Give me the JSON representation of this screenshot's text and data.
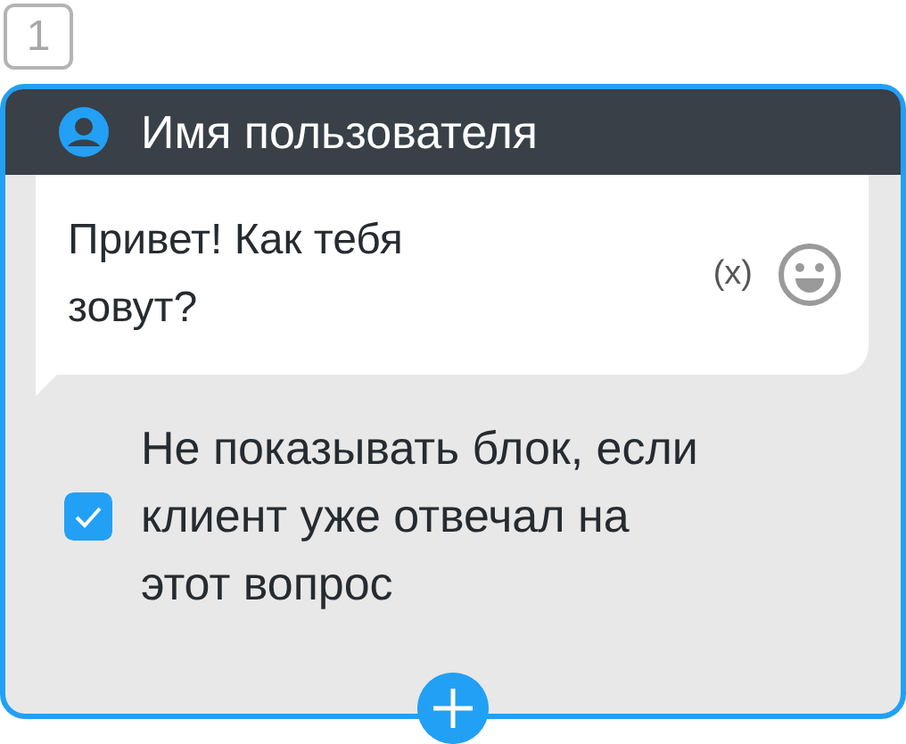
{
  "block_number": "1",
  "header": {
    "title": "Имя пользователя"
  },
  "message": {
    "text": "Привет! Как тебя зовут?",
    "variable_button": "(x)"
  },
  "option": {
    "label": "Не показывать блок, если клиент уже отвечал на этот вопрос",
    "checked": true
  }
}
